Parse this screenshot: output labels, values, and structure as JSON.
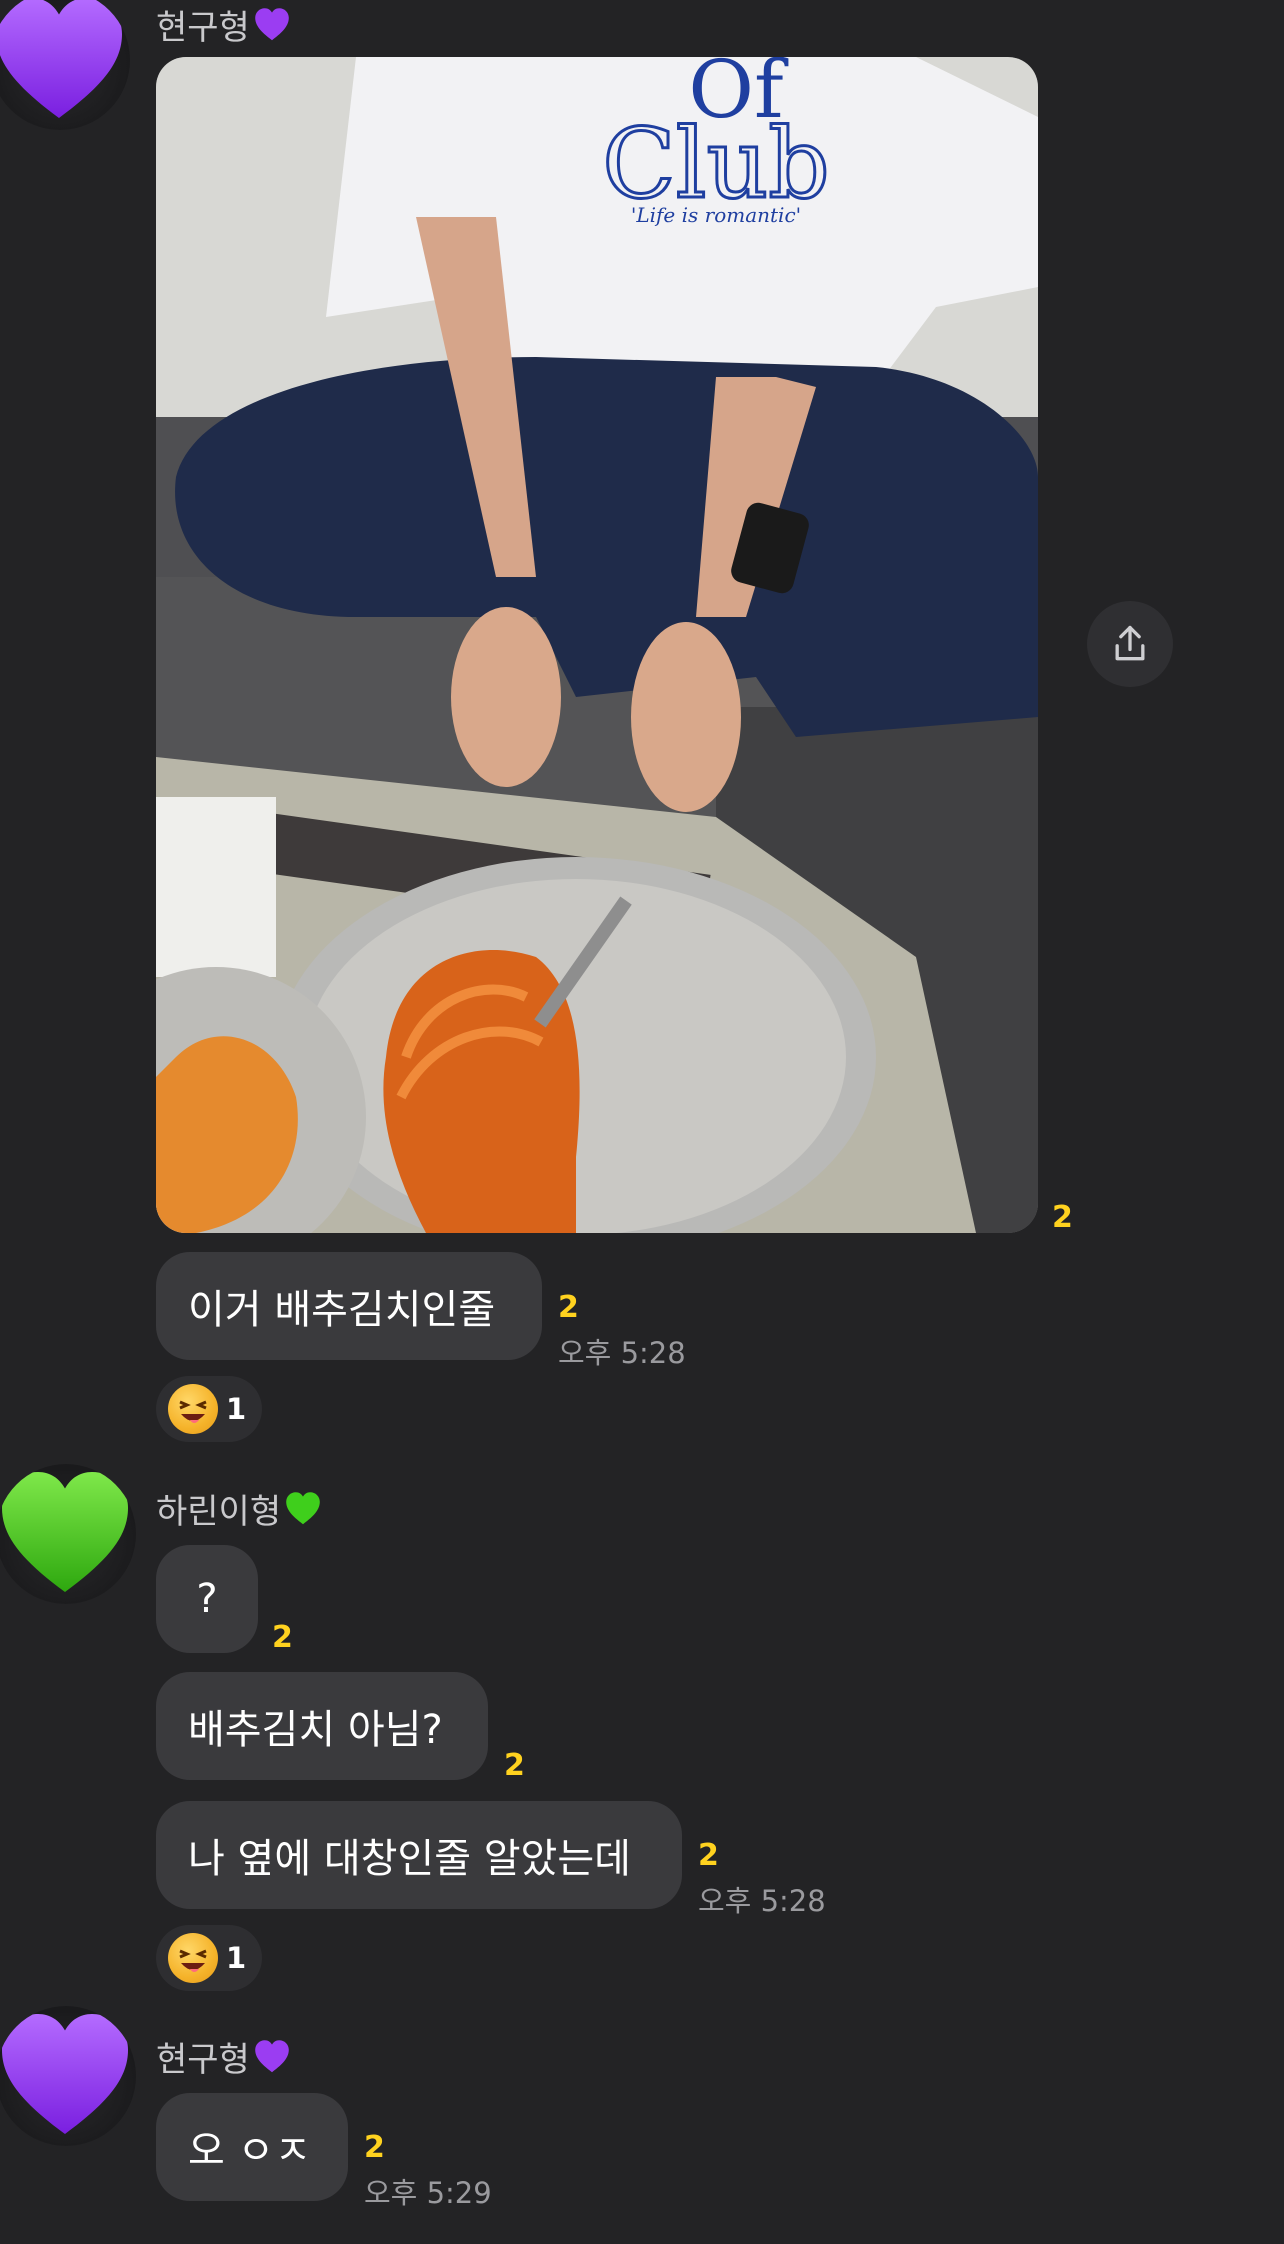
{
  "messages": {
    "group1": {
      "sender": "현구형",
      "photo_unread": "2",
      "bubble_text": "이거 배추김치인줄",
      "bubble_unread": "2",
      "bubble_time": "오후 5:28",
      "reaction_count": "1"
    },
    "group2": {
      "sender": "하린이형",
      "msg1_text": "?",
      "msg1_unread": "2",
      "msg2_text": "배추김치 아님?",
      "msg2_unread": "2",
      "msg3_text": "나 옆에 대창인줄 알았는데",
      "msg3_unread": "2",
      "msg3_time": "오후 5:28",
      "reaction_count": "1"
    },
    "group3": {
      "sender": "현구형",
      "msg_text": "오 ㅇㅈ",
      "msg_unread": "2",
      "msg_time": "오후 5:29"
    }
  },
  "photo_print": {
    "line1": "Of",
    "line2": "Club",
    "line3": "'Life is romantic'"
  },
  "colors": {
    "background": "#232325",
    "bubble": "#3a3a3d",
    "unread": "#ffd21f",
    "purple_heart": "#9b3df2",
    "green_heart": "#3fcf1c"
  },
  "icons": {
    "avatar1": "purple-heart-icon",
    "avatar2": "green-heart-icon",
    "share": "share-icon",
    "reaction": "laughing-face-icon"
  }
}
